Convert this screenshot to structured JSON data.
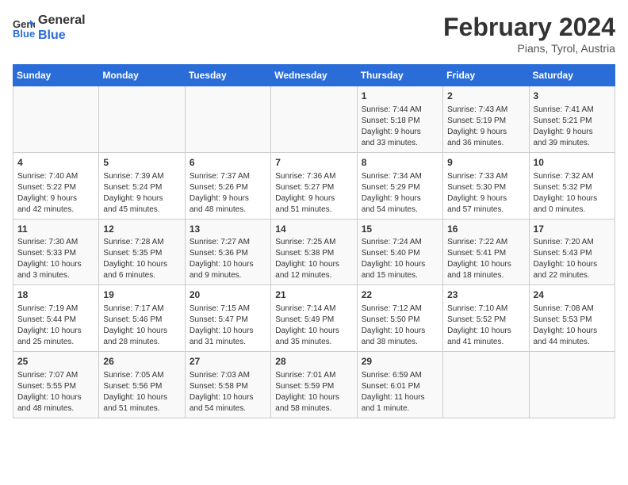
{
  "header": {
    "logo_line1": "General",
    "logo_line2": "Blue",
    "month_year": "February 2024",
    "location": "Pians, Tyrol, Austria"
  },
  "days_of_week": [
    "Sunday",
    "Monday",
    "Tuesday",
    "Wednesday",
    "Thursday",
    "Friday",
    "Saturday"
  ],
  "weeks": [
    [
      {
        "day": "",
        "info": ""
      },
      {
        "day": "",
        "info": ""
      },
      {
        "day": "",
        "info": ""
      },
      {
        "day": "",
        "info": ""
      },
      {
        "day": "1",
        "info": "Sunrise: 7:44 AM\nSunset: 5:18 PM\nDaylight: 9 hours\nand 33 minutes."
      },
      {
        "day": "2",
        "info": "Sunrise: 7:43 AM\nSunset: 5:19 PM\nDaylight: 9 hours\nand 36 minutes."
      },
      {
        "day": "3",
        "info": "Sunrise: 7:41 AM\nSunset: 5:21 PM\nDaylight: 9 hours\nand 39 minutes."
      }
    ],
    [
      {
        "day": "4",
        "info": "Sunrise: 7:40 AM\nSunset: 5:22 PM\nDaylight: 9 hours\nand 42 minutes."
      },
      {
        "day": "5",
        "info": "Sunrise: 7:39 AM\nSunset: 5:24 PM\nDaylight: 9 hours\nand 45 minutes."
      },
      {
        "day": "6",
        "info": "Sunrise: 7:37 AM\nSunset: 5:26 PM\nDaylight: 9 hours\nand 48 minutes."
      },
      {
        "day": "7",
        "info": "Sunrise: 7:36 AM\nSunset: 5:27 PM\nDaylight: 9 hours\nand 51 minutes."
      },
      {
        "day": "8",
        "info": "Sunrise: 7:34 AM\nSunset: 5:29 PM\nDaylight: 9 hours\nand 54 minutes."
      },
      {
        "day": "9",
        "info": "Sunrise: 7:33 AM\nSunset: 5:30 PM\nDaylight: 9 hours\nand 57 minutes."
      },
      {
        "day": "10",
        "info": "Sunrise: 7:32 AM\nSunset: 5:32 PM\nDaylight: 10 hours\nand 0 minutes."
      }
    ],
    [
      {
        "day": "11",
        "info": "Sunrise: 7:30 AM\nSunset: 5:33 PM\nDaylight: 10 hours\nand 3 minutes."
      },
      {
        "day": "12",
        "info": "Sunrise: 7:28 AM\nSunset: 5:35 PM\nDaylight: 10 hours\nand 6 minutes."
      },
      {
        "day": "13",
        "info": "Sunrise: 7:27 AM\nSunset: 5:36 PM\nDaylight: 10 hours\nand 9 minutes."
      },
      {
        "day": "14",
        "info": "Sunrise: 7:25 AM\nSunset: 5:38 PM\nDaylight: 10 hours\nand 12 minutes."
      },
      {
        "day": "15",
        "info": "Sunrise: 7:24 AM\nSunset: 5:40 PM\nDaylight: 10 hours\nand 15 minutes."
      },
      {
        "day": "16",
        "info": "Sunrise: 7:22 AM\nSunset: 5:41 PM\nDaylight: 10 hours\nand 18 minutes."
      },
      {
        "day": "17",
        "info": "Sunrise: 7:20 AM\nSunset: 5:43 PM\nDaylight: 10 hours\nand 22 minutes."
      }
    ],
    [
      {
        "day": "18",
        "info": "Sunrise: 7:19 AM\nSunset: 5:44 PM\nDaylight: 10 hours\nand 25 minutes."
      },
      {
        "day": "19",
        "info": "Sunrise: 7:17 AM\nSunset: 5:46 PM\nDaylight: 10 hours\nand 28 minutes."
      },
      {
        "day": "20",
        "info": "Sunrise: 7:15 AM\nSunset: 5:47 PM\nDaylight: 10 hours\nand 31 minutes."
      },
      {
        "day": "21",
        "info": "Sunrise: 7:14 AM\nSunset: 5:49 PM\nDaylight: 10 hours\nand 35 minutes."
      },
      {
        "day": "22",
        "info": "Sunrise: 7:12 AM\nSunset: 5:50 PM\nDaylight: 10 hours\nand 38 minutes."
      },
      {
        "day": "23",
        "info": "Sunrise: 7:10 AM\nSunset: 5:52 PM\nDaylight: 10 hours\nand 41 minutes."
      },
      {
        "day": "24",
        "info": "Sunrise: 7:08 AM\nSunset: 5:53 PM\nDaylight: 10 hours\nand 44 minutes."
      }
    ],
    [
      {
        "day": "25",
        "info": "Sunrise: 7:07 AM\nSunset: 5:55 PM\nDaylight: 10 hours\nand 48 minutes."
      },
      {
        "day": "26",
        "info": "Sunrise: 7:05 AM\nSunset: 5:56 PM\nDaylight: 10 hours\nand 51 minutes."
      },
      {
        "day": "27",
        "info": "Sunrise: 7:03 AM\nSunset: 5:58 PM\nDaylight: 10 hours\nand 54 minutes."
      },
      {
        "day": "28",
        "info": "Sunrise: 7:01 AM\nSunset: 5:59 PM\nDaylight: 10 hours\nand 58 minutes."
      },
      {
        "day": "29",
        "info": "Sunrise: 6:59 AM\nSunset: 6:01 PM\nDaylight: 11 hours\nand 1 minute."
      },
      {
        "day": "",
        "info": ""
      },
      {
        "day": "",
        "info": ""
      }
    ]
  ]
}
